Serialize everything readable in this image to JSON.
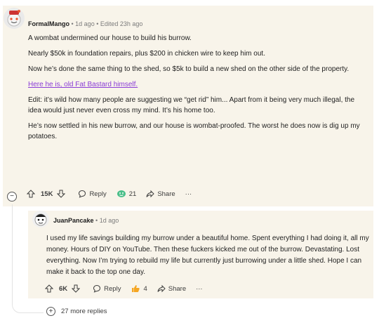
{
  "comment": {
    "author": "FormalMango",
    "meta": " • 1d ago • Edited 23h ago",
    "paragraphs": [
      "A wombat undermined our house to build his burrow.",
      "Nearly $50k in foundation repairs, plus $200 in chicken wire to keep him out.",
      "Now he’s done the same thing to the shed, so $5k to build a new shed on the other side of the property."
    ],
    "link_text": "Here he is, old Fat Bastard himself.",
    "paragraphs_after": [
      "Edit: it’s wild how many people are suggesting we “get rid” him... Apart from it being very much illegal, the idea would just never even cross my mind. It’s his home too.",
      "He’s now settled in his new burrow, and our house is wombat-proofed. The worst he does now is dig up my potatoes."
    ],
    "votes": "15K",
    "reply_label": "Reply",
    "award_count": "21",
    "share_label": "Share",
    "more_label": "···"
  },
  "reply": {
    "author": "JuanPancake",
    "meta": " • 1d ago",
    "text": "I used my life savings building my burrow under a beautiful home. Spent everything I had doing it, all my money. Hours of DIY on YouTube. Then these fuckers kicked me out of the burrow. Devastating. Lost everything. Now I’m trying to rebuild my life but currently just burrowing under a little shed. Hope I can make it back to the top one day.",
    "votes": "6K",
    "reply_label": "Reply",
    "award_count": "4",
    "share_label": "Share",
    "more_label": "···"
  },
  "more_replies": "27 more replies",
  "collapse_symbol": "−",
  "expand_symbol": "+",
  "icons": {
    "avatar1": "snoo-avatar-icon",
    "avatar2": "snoo-avatar-icon",
    "upvote": "upvote-arrow-icon",
    "downvote": "downvote-arrow-icon",
    "reply": "speech-bubble-icon",
    "award1": "green-emoji-award-icon",
    "award2": "thumbs-up-award-icon",
    "share": "share-arrow-icon"
  },
  "colors": {
    "link": "#8a3cd6",
    "comment_bg": "#f8f4ea"
  }
}
